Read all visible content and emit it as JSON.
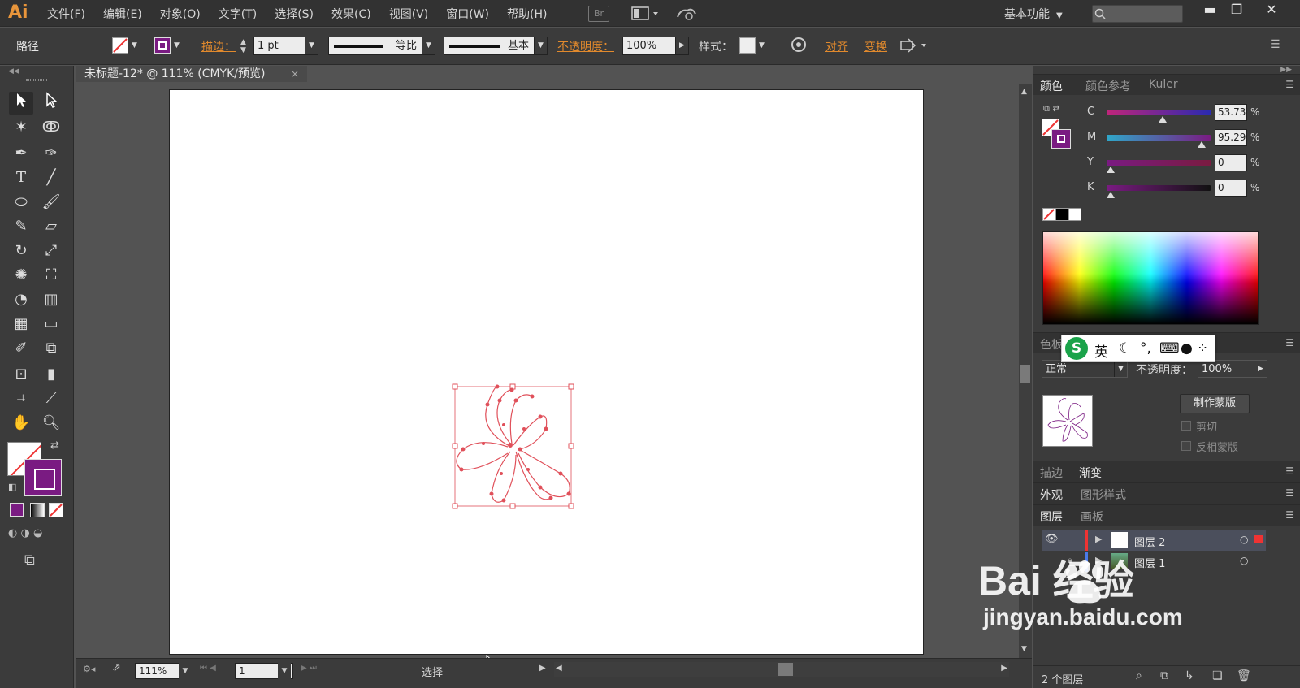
{
  "menubar": {
    "logo": "Ai",
    "menus": [
      "文件(F)",
      "编辑(E)",
      "对象(O)",
      "文字(T)",
      "选择(S)",
      "效果(C)",
      "视图(V)",
      "窗口(W)",
      "帮助(H)"
    ],
    "bridge": "Br",
    "workspace": "基本功能",
    "window_minimize": "▬",
    "window_restore": "❐",
    "window_close": "✕"
  },
  "controlbar": {
    "object_label": "路径",
    "stroke_label": "描边：",
    "stroke_weight": "1 pt",
    "stroke_profile": "等比",
    "brush": "基本",
    "opacity_label": "不透明度：",
    "opacity_value": "100%",
    "style_label": "样式：",
    "align": "对齐",
    "transform": "变换"
  },
  "document": {
    "tab_title": "未标题-12* @ 111% (CMYK/预览)",
    "close": "×"
  },
  "statusbar": {
    "zoom": "111%",
    "page": "1",
    "mode": "选择"
  },
  "color_panel": {
    "tabs": [
      "颜色",
      "颜色参考",
      "Kuler"
    ],
    "channels": [
      {
        "label": "C",
        "value": "53.73",
        "level": 0.54
      },
      {
        "label": "M",
        "value": "95.29",
        "level": 0.95
      },
      {
        "label": "Y",
        "value": "0",
        "level": 0
      },
      {
        "label": "K",
        "value": "0",
        "level": 0
      }
    ],
    "percent": "%"
  },
  "transparency_panel": {
    "tab_visible": "色板",
    "blend_mode": "正常",
    "opacity_label": "不透明度：",
    "opacity_value": "100%",
    "make_mask": "制作蒙版",
    "clip": "剪切",
    "invert_mask": "反相蒙版"
  },
  "panels": {
    "stroke_tab": "描边",
    "gradient_tab": "渐变",
    "appearance_tab": "外观",
    "graphic_styles_tab": "图形样式",
    "layers_tab": "图层",
    "artboards_tab": "画板"
  },
  "layers": {
    "items": [
      {
        "name": "图层 2"
      },
      {
        "name": "图层 1"
      }
    ],
    "count": "2 个图层"
  },
  "ime_bar": {
    "lang": "英"
  },
  "watermark": {
    "brand": "Bai  经验",
    "url": "jingyan.baidu.com"
  },
  "colors": {
    "accent": "#e28a2d",
    "stroke_purple": "#7a1b82",
    "selection": "#e0505a"
  }
}
